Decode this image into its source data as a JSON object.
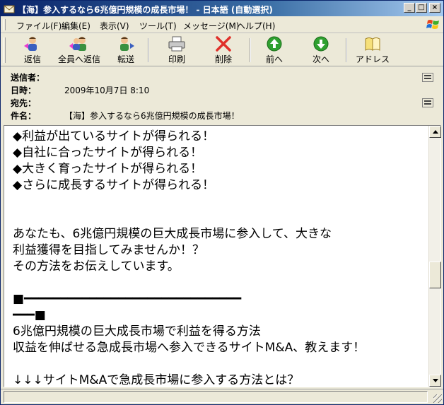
{
  "window": {
    "title": "【海】参入するなら6兆億円規模の成長市場！ - 日本語 (自動選択)",
    "min_label": "_",
    "max_label": "□",
    "close_label": "×"
  },
  "menu": {
    "items": [
      {
        "label": "ファイル(F)"
      },
      {
        "label": "編集(E)"
      },
      {
        "label": "表示(V)"
      },
      {
        "label": "ツール(T)"
      },
      {
        "label": "メッセージ(M)"
      },
      {
        "label": "ヘルプ(H)"
      }
    ]
  },
  "toolbar": {
    "reply": "返信",
    "reply_all": "全員へ返信",
    "forward": "転送",
    "print": "印刷",
    "delete": "削除",
    "previous": "前へ",
    "next": "次へ",
    "address": "アドレス"
  },
  "headers": {
    "from_label": "送信者：",
    "from_value": "",
    "date_label": "日時：",
    "date_value": "2009年10月7日 8:10",
    "to_label": "宛先：",
    "to_value": "",
    "subject_label": "件名：",
    "subject_value": "【海】参入するなら6兆億円規模の成長市場！"
  },
  "message": {
    "body": "◆利益が出ているサイトが得られる！\n◆自社に合ったサイトが得られる！\n◆大きく育ったサイトが得られる！\n◆さらに成長するサイトが得られる！\n\n\nあなたも、6兆億円規模の巨大成長市場に参入して、大きな\n利益獲得を目指してみませんか！？\nその方法をお伝えしています。\n\n■━━━━━━━━━━━━━━━━━━━━━━━━━━━━━━\n━━━■\n6兆億円規模の巨大成長市場で利益を得る方法\n収益を伸ばせる急成長市場へ参入できるサイトM&A、教えます！\n\n↓↓↓サイトM&Aで急成長市場に参入する方法とは？"
  },
  "colors": {
    "titlebar_start": "#0a246a",
    "titlebar_end": "#a6caf0",
    "prev_next_green": "#2fa02f",
    "delete_red": "#e0302a"
  }
}
